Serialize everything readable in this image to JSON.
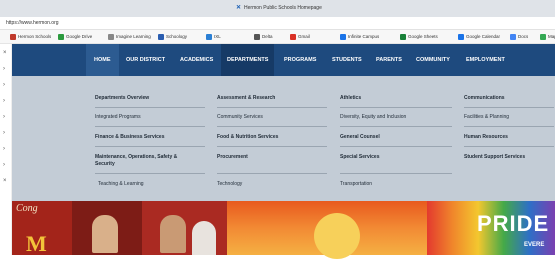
{
  "browser": {
    "tab_title": "Hermon Public Schools Homepage",
    "url": "https://www.hermon.org",
    "bookmarks": [
      {
        "label": "Hermon Schools",
        "color": "#c0392b"
      },
      {
        "label": "Google Drive",
        "color": "#2b9a3e"
      },
      {
        "label": "Imagine Learning",
        "color": "#888888"
      },
      {
        "label": "Schoology",
        "color": "#2a5db0"
      },
      {
        "label": "IXL",
        "color": "#2a7fd4"
      },
      {
        "label": "Delta",
        "color": "#555555"
      },
      {
        "label": "Gmail",
        "color": "#d93025"
      },
      {
        "label": "Infinite Campus",
        "color": "#1a73e8"
      },
      {
        "label": "Google Sheets",
        "color": "#188038"
      },
      {
        "label": "Google Calendar",
        "color": "#1a73e8"
      },
      {
        "label": "Docs",
        "color": "#4285f4"
      },
      {
        "label": "Maps",
        "color": "#34a853"
      }
    ]
  },
  "nav": {
    "items": [
      "HOME",
      "OUR DISTRICT",
      "ACADEMICS",
      "DEPARTMENTS",
      "PROGRAMS",
      "STUDENTS",
      "PARENTS",
      "COMMUNITY",
      "EMPLOYMENT"
    ]
  },
  "departments_menu": {
    "col1": [
      "Departments Overview",
      "Integrated Programs",
      "Finance & Business Services",
      "Maintenance, Operations, Safety & Security",
      "Teaching & Learning"
    ],
    "col2": [
      "Assessment & Research",
      "Community Services",
      "Food & Nutrition Services",
      "Procurement",
      "Technology"
    ],
    "col3": [
      "Athletics",
      "Diversity, Equity and Inclusion",
      "General Counsel",
      "Special Services",
      "Transportation"
    ],
    "col4": [
      "Communications",
      "Facilities & Planning",
      "Human Resources",
      "Student Support Services"
    ]
  },
  "banner": {
    "pride_text": "PRIDE M",
    "logo_letter": "M",
    "ever_text": "EVERE"
  },
  "colors": {
    "nav_bg": "#1e4a7e",
    "dropdown_bg": "#c3ccd6"
  }
}
